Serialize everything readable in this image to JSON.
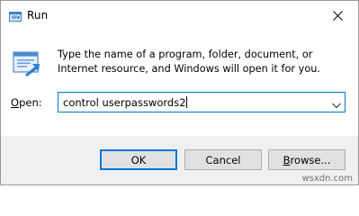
{
  "window": {
    "title": "Run",
    "icon": "run-icon",
    "close_icon": "close-icon"
  },
  "main": {
    "description": "Type the name of a program, folder, document, or Internet resource, and Windows will open it for you.",
    "icon": "run-dialog-icon",
    "open_label_accel": "O",
    "open_label_rest": "pen:",
    "open_value": "control userpasswords2",
    "dropdown_icon": "chevron-down-icon"
  },
  "buttons": {
    "ok": "OK",
    "cancel": "Cancel",
    "browse_accel": "B",
    "browse_rest": "rowse..."
  },
  "watermark": "wsxdn.com",
  "colors": {
    "focus_border": "#0078d7",
    "footer_bg": "#f0f0f0",
    "button_bg": "#e1e1e1"
  }
}
